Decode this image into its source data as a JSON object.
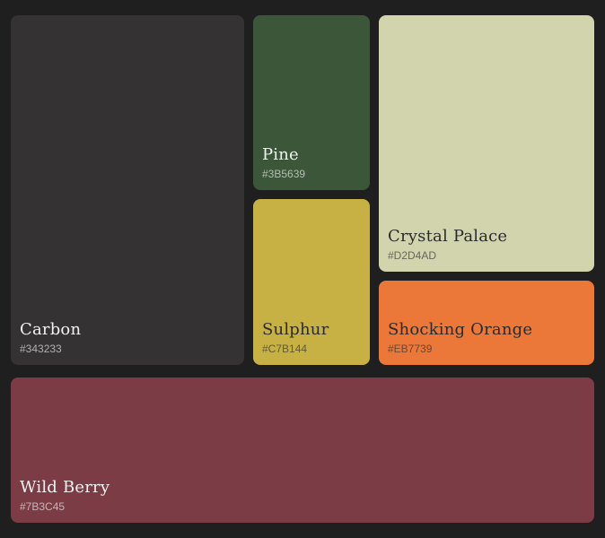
{
  "swatches": {
    "carbon": {
      "name": "Carbon",
      "hex": "#343233",
      "color": "#343233"
    },
    "pine": {
      "name": "Pine",
      "hex": "#3B5639",
      "color": "#3B5639"
    },
    "sulphur": {
      "name": "Sulphur",
      "hex": "#C7B144",
      "color": "#C7B144"
    },
    "crystal_palace": {
      "name": "Crystal Palace",
      "hex": "#D2D4AD",
      "color": "#D2D4AD"
    },
    "shocking_orange": {
      "name": "Shocking Orange",
      "hex": "#EB7739",
      "color": "#EB7739"
    },
    "wild_berry": {
      "name": "Wild Berry",
      "hex": "#7B3C45",
      "color": "#7B3C45"
    }
  },
  "background": "#1F1F1F"
}
